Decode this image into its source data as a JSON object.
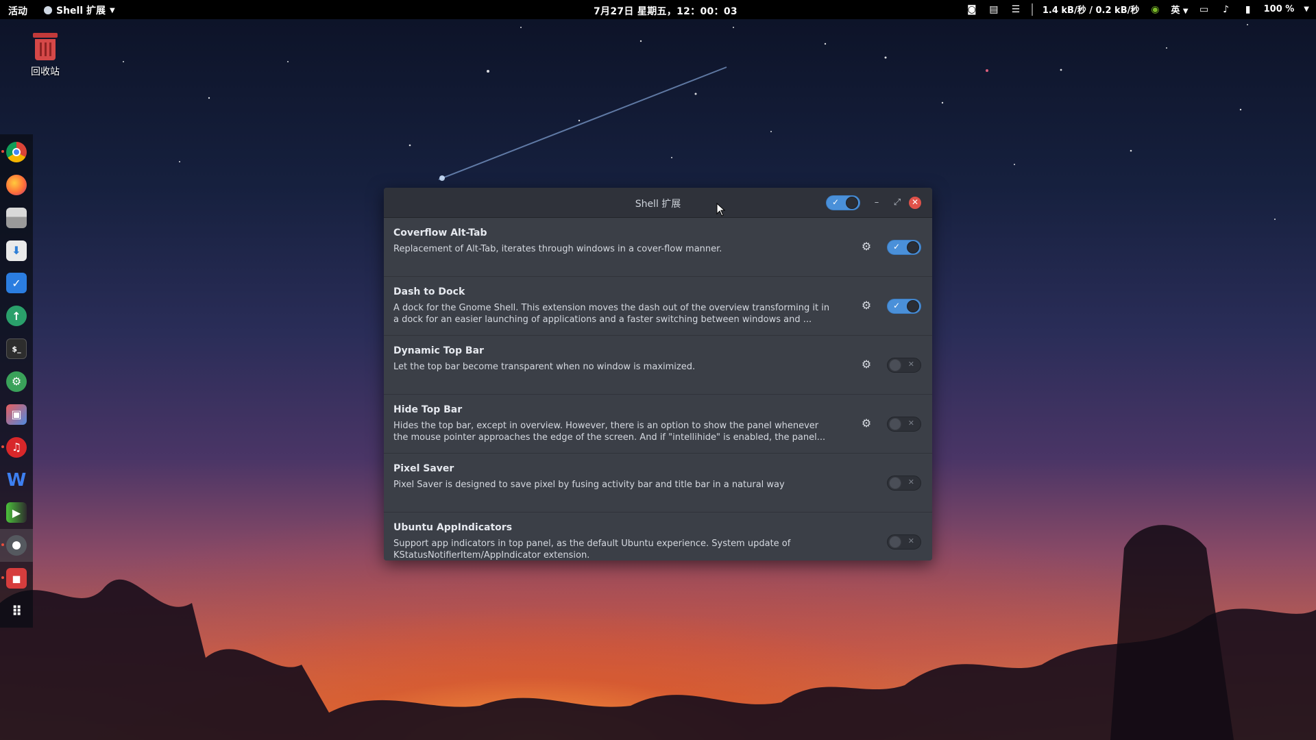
{
  "topbar": {
    "activities": "活动",
    "app_name": "Shell 扩展",
    "clock": "7月27日 星期五，12：00：03",
    "network_speed": "1.4 kB/秒 / 0.2 kB/秒",
    "input_method": "英",
    "battery": "100 %",
    "icons": [
      "camera-icon",
      "notes-icon",
      "menu-icon",
      "nvidia-icon",
      "display-icon",
      "volume-icon",
      "battery-icon"
    ]
  },
  "desktop": {
    "trash_label": "回收站"
  },
  "dock": {
    "items": [
      {
        "name": "chrome-icon",
        "running": true
      },
      {
        "name": "firefox-icon",
        "running": false
      },
      {
        "name": "files-icon",
        "running": false
      },
      {
        "name": "software-store-icon",
        "running": false
      },
      {
        "name": "tasks-icon",
        "running": false
      },
      {
        "name": "upload-icon",
        "running": false
      },
      {
        "name": "terminal-icon",
        "running": false
      },
      {
        "name": "tweaks-icon",
        "running": false
      },
      {
        "name": "screenshot-icon",
        "running": false
      },
      {
        "name": "netease-music-icon",
        "running": true
      },
      {
        "name": "wps-writer-icon",
        "running": false
      },
      {
        "name": "media-player-icon",
        "running": false
      },
      {
        "name": "settings-icon",
        "running": true
      },
      {
        "name": "screen-recorder-icon",
        "running": true
      },
      {
        "name": "app-grid-icon",
        "running": false
      }
    ]
  },
  "window": {
    "title": "Shell 扩展",
    "master_switch_on": true,
    "extensions": [
      {
        "name": "Coverflow Alt-Tab",
        "description": "Replacement of Alt-Tab, iterates through windows in a cover-flow manner.",
        "has_settings": true,
        "enabled": true
      },
      {
        "name": "Dash to Dock",
        "description": "A dock for the Gnome Shell. This extension moves the dash out of the overview transforming it in a dock for an easier launching of applications and a faster switching between windows and ...",
        "has_settings": true,
        "enabled": true
      },
      {
        "name": "Dynamic Top Bar",
        "description": "Let the top bar become transparent when no window is maximized.",
        "has_settings": true,
        "enabled": false
      },
      {
        "name": "Hide Top Bar",
        "description": "Hides the top bar, except in overview. However, there is an option to show the panel whenever the mouse pointer approaches the edge of the screen. And if \"intellihide\" is enabled, the panel...",
        "has_settings": true,
        "enabled": false
      },
      {
        "name": "Pixel Saver",
        "description": "Pixel Saver is designed to save pixel by fusing activity bar and title bar in a natural way",
        "has_settings": false,
        "enabled": false
      },
      {
        "name": "Ubuntu AppIndicators",
        "description": "Support app indicators in top panel, as the default Ubuntu experience. System update of KStatusNotifierItem/AppIndicator extension.",
        "has_settings": false,
        "enabled": false
      }
    ]
  }
}
